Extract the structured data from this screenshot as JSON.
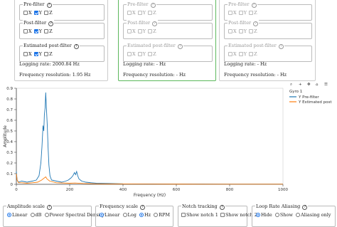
{
  "panels": [
    {
      "pre_filter": {
        "legend": "Pre-filter",
        "axes": [
          {
            "label": "X",
            "checked": false
          },
          {
            "label": "Y",
            "checked": true
          },
          {
            "label": "Z",
            "checked": false
          }
        ]
      },
      "post_filter": {
        "legend": "Post-filter",
        "axes": [
          {
            "label": "X",
            "checked": false
          },
          {
            "label": "Y",
            "checked": true
          },
          {
            "label": "Z",
            "checked": false
          }
        ]
      },
      "est_post_filter": {
        "legend": "Estimated post-filter",
        "axes": [
          {
            "label": "X",
            "checked": false
          },
          {
            "label": "Y",
            "checked": true
          },
          {
            "label": "Z",
            "checked": false
          }
        ]
      },
      "logging_rate": "Logging rate: 2000.84 Hz",
      "freq_resolution": "Frequency resolution: 1.95 Hz"
    },
    {
      "pre_filter": {
        "legend": "Pre-filter",
        "axes": [
          {
            "label": "X",
            "checked": false
          },
          {
            "label": "Y",
            "checked": false
          },
          {
            "label": "Z",
            "checked": false
          }
        ]
      },
      "post_filter": {
        "legend": "Post-filter",
        "axes": [
          {
            "label": "X",
            "checked": false
          },
          {
            "label": "Y",
            "checked": false
          },
          {
            "label": "Z",
            "checked": false
          }
        ]
      },
      "est_post_filter": {
        "legend": "Estimated post-filter",
        "axes": [
          {
            "label": "X",
            "checked": false
          },
          {
            "label": "Y",
            "checked": false
          },
          {
            "label": "Z",
            "checked": false
          }
        ]
      },
      "logging_rate": "Logging rate: - Hz",
      "freq_resolution": "Frequency resolution: - Hz"
    },
    {
      "pre_filter": {
        "legend": "Pre-filter",
        "axes": [
          {
            "label": "X",
            "checked": false
          },
          {
            "label": "Y",
            "checked": false
          },
          {
            "label": "Z",
            "checked": false
          }
        ]
      },
      "post_filter": {
        "legend": "Post-filter",
        "axes": [
          {
            "label": "X",
            "checked": false
          },
          {
            "label": "Y",
            "checked": false
          },
          {
            "label": "Z",
            "checked": false
          }
        ]
      },
      "est_post_filter": {
        "legend": "Estimated post-filter",
        "axes": [
          {
            "label": "X",
            "checked": false
          },
          {
            "label": "Y",
            "checked": false
          },
          {
            "label": "Z",
            "checked": false
          }
        ]
      },
      "logging_rate": "Logging rate: - Hz",
      "freq_resolution": "Frequency resolution: - Hz"
    }
  ],
  "help_glyph": "?",
  "toolbar": {
    "icons": [
      "zoom-icon",
      "zoom-in-icon",
      "pan-icon",
      "reset-icon",
      "menu-icon"
    ]
  },
  "chart_data": {
    "type": "line",
    "xlabel": "Frequency (Hz)",
    "ylabel": "Amplitude",
    "xlim": [
      0,
      1000
    ],
    "ylim": [
      0,
      0.9
    ],
    "x_ticks": [
      "0",
      "200",
      "400",
      "600",
      "800",
      "1000"
    ],
    "y_ticks": [
      "0",
      "0.1",
      "0.2",
      "0.3",
      "0.4",
      "0.5",
      "0.6",
      "0.7",
      "0.8",
      "0.9"
    ],
    "legend_title": "Gyro 1",
    "legend_position": "top-right",
    "grid": false,
    "series": [
      {
        "name": "Y Pre-filter",
        "color": "#1f77b4",
        "points": [
          [
            0,
            0.12
          ],
          [
            3,
            0.04
          ],
          [
            8,
            0.02
          ],
          [
            20,
            0.03
          ],
          [
            40,
            0.02
          ],
          [
            60,
            0.03
          ],
          [
            75,
            0.04
          ],
          [
            85,
            0.08
          ],
          [
            92,
            0.2
          ],
          [
            96,
            0.35
          ],
          [
            100,
            0.55
          ],
          [
            103,
            0.5
          ],
          [
            105,
            0.65
          ],
          [
            108,
            0.72
          ],
          [
            110,
            0.86
          ],
          [
            113,
            0.7
          ],
          [
            116,
            0.55
          ],
          [
            119,
            0.35
          ],
          [
            122,
            0.18
          ],
          [
            126,
            0.08
          ],
          [
            132,
            0.04
          ],
          [
            150,
            0.03
          ],
          [
            170,
            0.02
          ],
          [
            185,
            0.03
          ],
          [
            195,
            0.04
          ],
          [
            205,
            0.06
          ],
          [
            212,
            0.08
          ],
          [
            218,
            0.11
          ],
          [
            222,
            0.09
          ],
          [
            226,
            0.12
          ],
          [
            230,
            0.08
          ],
          [
            235,
            0.05
          ],
          [
            245,
            0.03
          ],
          [
            260,
            0.02
          ],
          [
            300,
            0.01
          ],
          [
            350,
            0.008
          ],
          [
            400,
            0.005
          ],
          [
            500,
            0.004
          ],
          [
            600,
            0.003
          ],
          [
            700,
            0.003
          ],
          [
            800,
            0.002
          ],
          [
            900,
            0.002
          ],
          [
            1000,
            0.002
          ]
        ]
      },
      {
        "name": "Y Estimated post",
        "color": "#ff7f0e",
        "points": [
          [
            0,
            0.1
          ],
          [
            3,
            0.04
          ],
          [
            8,
            0.015
          ],
          [
            20,
            0.015
          ],
          [
            40,
            0.01
          ],
          [
            60,
            0.015
          ],
          [
            80,
            0.02
          ],
          [
            95,
            0.04
          ],
          [
            105,
            0.06
          ],
          [
            110,
            0.07
          ],
          [
            115,
            0.05
          ],
          [
            125,
            0.03
          ],
          [
            150,
            0.015
          ],
          [
            200,
            0.01
          ],
          [
            220,
            0.012
          ],
          [
            250,
            0.008
          ],
          [
            300,
            0.005
          ],
          [
            400,
            0.003
          ],
          [
            500,
            0.002
          ],
          [
            700,
            0.001
          ],
          [
            1000,
            0.001
          ]
        ]
      }
    ]
  },
  "controls": {
    "amplitude_scale": {
      "legend": "Amplitude scale",
      "options": [
        {
          "label": "Linear",
          "selected": true
        },
        {
          "label": "dB",
          "selected": false
        },
        {
          "label": "Power Spectral Density",
          "selected": false
        }
      ]
    },
    "frequency_scale": {
      "legend": "Frequency scale",
      "options": [
        {
          "label": "Linear",
          "selected": true
        },
        {
          "label": "Log",
          "selected": false
        },
        {
          "label": "Hz",
          "selected": true
        },
        {
          "label": "RPM",
          "selected": false
        }
      ]
    },
    "notch_tracking": {
      "legend": "Notch tracking",
      "options": [
        {
          "label": "Show notch 1",
          "checked": false
        },
        {
          "label": "Show notch 2",
          "checked": false
        }
      ]
    },
    "loop_rate_aliasing": {
      "legend": "Loop Rate Aliasing",
      "options": [
        {
          "label": "Hide",
          "selected": true
        },
        {
          "label": "Show",
          "selected": false
        },
        {
          "label": "Aliasing only",
          "selected": false
        }
      ]
    }
  }
}
